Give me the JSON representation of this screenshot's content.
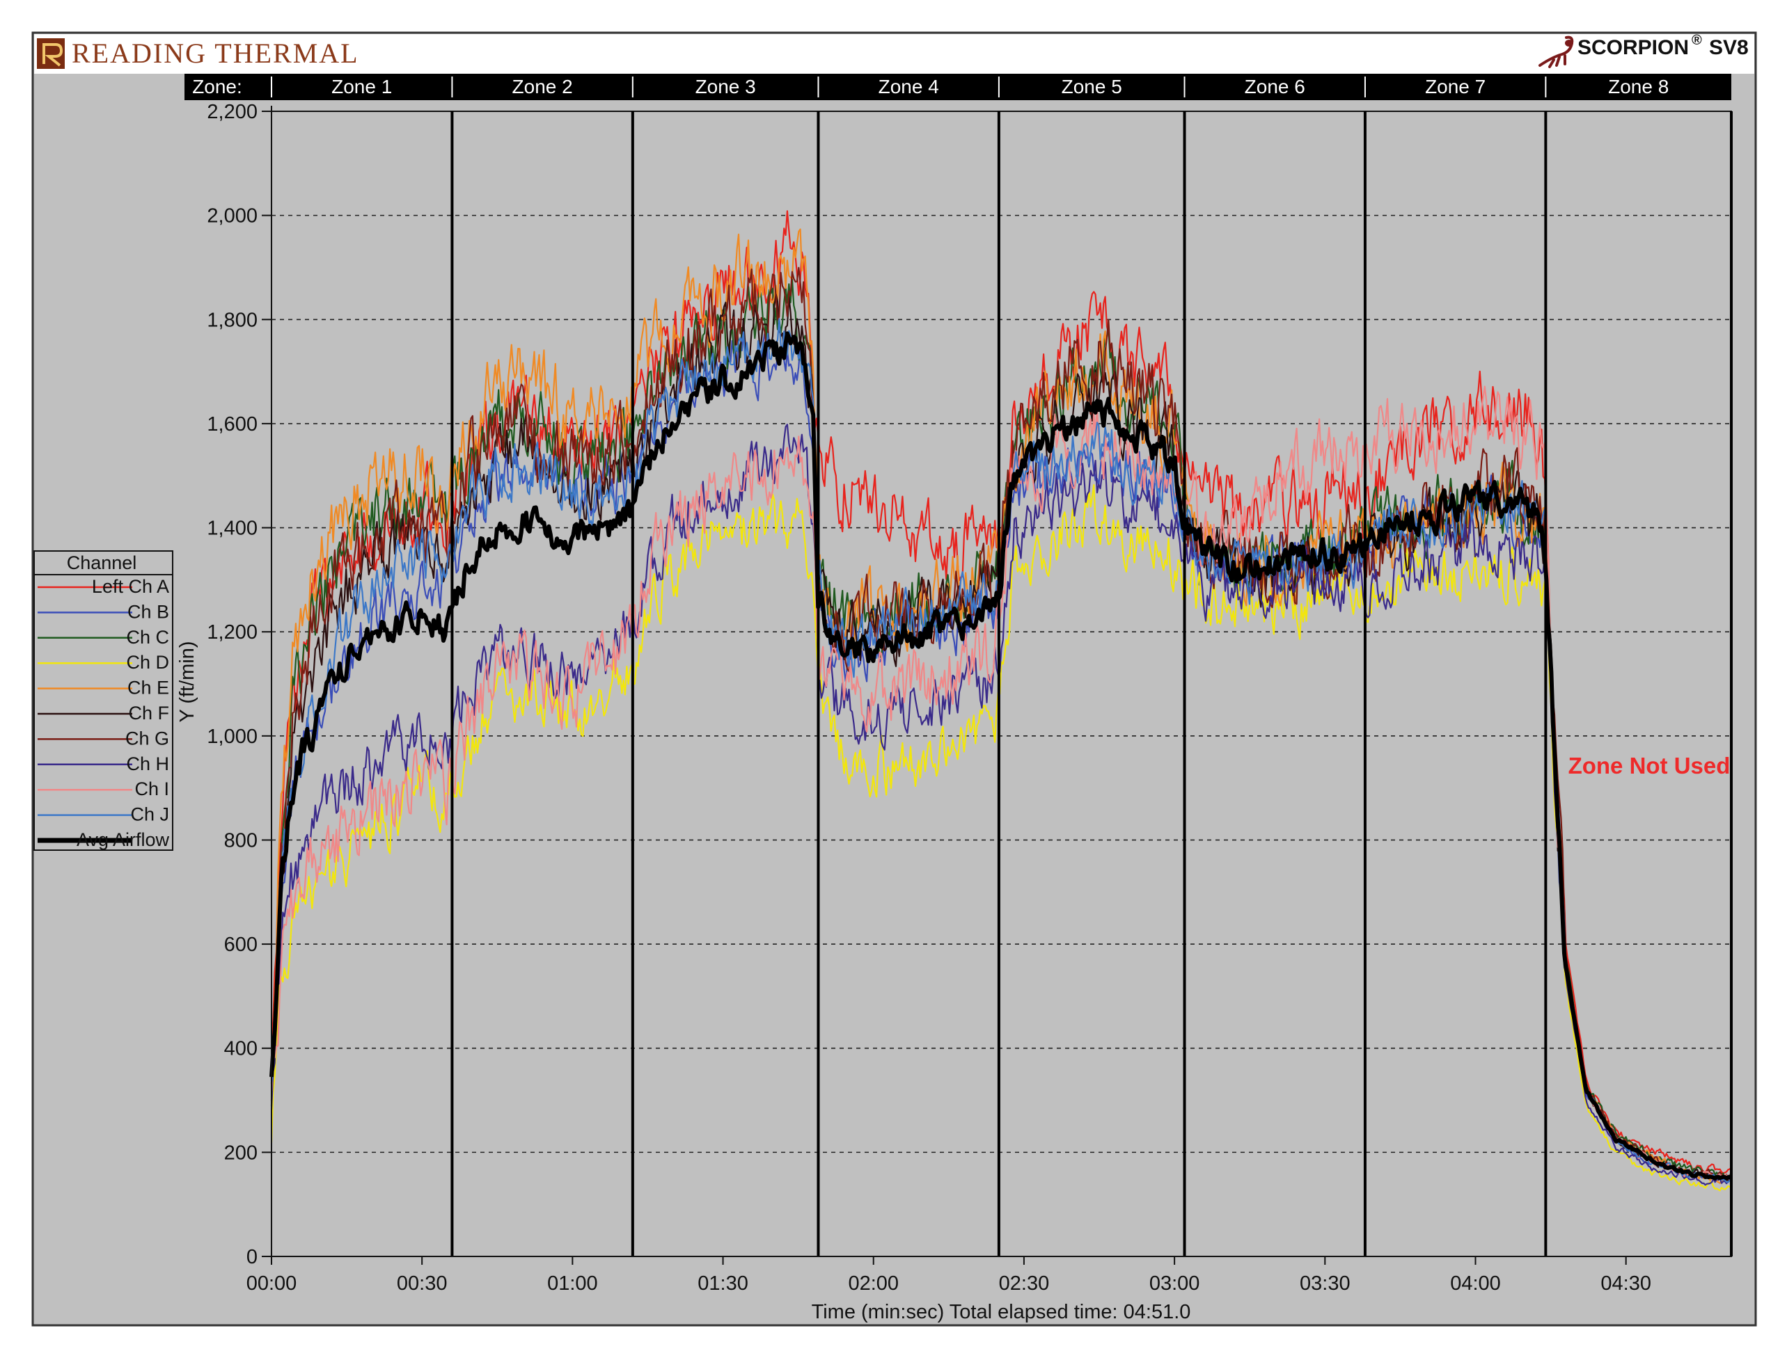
{
  "header": {
    "brand": "READING THERMAL",
    "product": "SCORPION",
    "product_mark": "®",
    "product_model": "SV8"
  },
  "zone_header": {
    "row_label": "Zone:",
    "zones": [
      "Zone 1",
      "Zone 2",
      "Zone 3",
      "Zone 4",
      "Zone 5",
      "Zone 6",
      "Zone 7",
      "Zone 8"
    ]
  },
  "legend": {
    "title": "Channel",
    "items": [
      "Left Ch A",
      "Ch B",
      "Ch C",
      "Ch D",
      "Ch E",
      "Ch F",
      "Ch G",
      "Ch H",
      "Ch I",
      "Ch J",
      "Avg Airflow"
    ]
  },
  "annotation": "Zone Not Used",
  "colors": {
    "plot_background": "#c0c0c0",
    "header_bar": "#000000",
    "annotation": "#ee2a2a"
  },
  "chart_data": {
    "type": "line",
    "title": "",
    "xlabel": "Time (min:sec) Total elapsed time: 04:51.0",
    "ylabel": "Y (ft/min)",
    "xlim": [
      0,
      291
    ],
    "ylim": [
      0,
      2200
    ],
    "x_ticks": [
      {
        "t": 0,
        "label": "00:00"
      },
      {
        "t": 30,
        "label": "00:30"
      },
      {
        "t": 60,
        "label": "01:00"
      },
      {
        "t": 90,
        "label": "01:30"
      },
      {
        "t": 120,
        "label": "02:00"
      },
      {
        "t": 150,
        "label": "02:30"
      },
      {
        "t": 180,
        "label": "03:00"
      },
      {
        "t": 210,
        "label": "03:30"
      },
      {
        "t": 240,
        "label": "04:00"
      },
      {
        "t": 270,
        "label": "04:30"
      }
    ],
    "y_ticks": [
      {
        "v": 0,
        "label": "0"
      },
      {
        "v": 200,
        "label": "200"
      },
      {
        "v": 400,
        "label": "400"
      },
      {
        "v": 600,
        "label": "600"
      },
      {
        "v": 800,
        "label": "800"
      },
      {
        "v": 1000,
        "label": "1,000"
      },
      {
        "v": 1200,
        "label": "1,200"
      },
      {
        "v": 1400,
        "label": "1,400"
      },
      {
        "v": 1600,
        "label": "1,600"
      },
      {
        "v": 1800,
        "label": "1,800"
      },
      {
        "v": 2000,
        "label": "2,000"
      },
      {
        "v": 2200,
        "label": "2,200"
      }
    ],
    "grid": "horizontal dashed",
    "legend_position": "left",
    "zone_boundaries": [
      0,
      36,
      72,
      109,
      145,
      182,
      218,
      254,
      291
    ],
    "zones": [
      {
        "name": "Zone 1",
        "start": 0,
        "end": 36
      },
      {
        "name": "Zone 2",
        "start": 36,
        "end": 72
      },
      {
        "name": "Zone 3",
        "start": 72,
        "end": 109
      },
      {
        "name": "Zone 4",
        "start": 109,
        "end": 145
      },
      {
        "name": "Zone 5",
        "start": 145,
        "end": 182
      },
      {
        "name": "Zone 6",
        "start": 182,
        "end": 218
      },
      {
        "name": "Zone 7",
        "start": 218,
        "end": 254
      },
      {
        "name": "Zone 8",
        "start": 254,
        "end": 291
      }
    ],
    "x": [
      0,
      2,
      4,
      6,
      8,
      10,
      13,
      16,
      20,
      25,
      30,
      33,
      35,
      36,
      40,
      45,
      50,
      55,
      60,
      65,
      70,
      72,
      75,
      80,
      85,
      90,
      95,
      100,
      103,
      106,
      108,
      109,
      112,
      115,
      120,
      125,
      130,
      135,
      140,
      144,
      145,
      148,
      152,
      155,
      160,
      165,
      170,
      175,
      180,
      182,
      185,
      190,
      195,
      200,
      205,
      210,
      215,
      218,
      220,
      225,
      230,
      235,
      240,
      245,
      250,
      253,
      254,
      256,
      258,
      262,
      268,
      275,
      283,
      291
    ],
    "series": [
      {
        "name": "Left Ch A",
        "color": "#e8231d",
        "width": 2.2,
        "noise": 55,
        "values": [
          380,
          850,
          1050,
          1150,
          1230,
          1260,
          1300,
          1330,
          1380,
          1420,
          1450,
          1430,
          1410,
          1440,
          1550,
          1600,
          1620,
          1580,
          1550,
          1560,
          1580,
          1560,
          1680,
          1760,
          1820,
          1850,
          1880,
          1920,
          1960,
          1880,
          1700,
          1550,
          1500,
          1470,
          1450,
          1420,
          1380,
          1360,
          1380,
          1390,
          1380,
          1600,
          1640,
          1680,
          1750,
          1800,
          1720,
          1700,
          1650,
          1520,
          1480,
          1450,
          1420,
          1440,
          1450,
          1460,
          1480,
          1450,
          1500,
          1560,
          1580,
          1600,
          1620,
          1640,
          1620,
          1560,
          1470,
          950,
          600,
          340,
          240,
          205,
          175,
          165
        ]
      },
      {
        "name": "Ch B",
        "color": "#3a4db8",
        "width": 2.2,
        "noise": 45,
        "values": [
          300,
          700,
          880,
          960,
          1020,
          1060,
          1120,
          1170,
          1210,
          1260,
          1290,
          1300,
          1310,
          1320,
          1440,
          1500,
          1520,
          1480,
          1460,
          1470,
          1490,
          1470,
          1560,
          1630,
          1680,
          1700,
          1720,
          1740,
          1760,
          1720,
          1600,
          1300,
          1200,
          1170,
          1180,
          1190,
          1200,
          1210,
          1240,
          1260,
          1300,
          1470,
          1500,
          1510,
          1530,
          1540,
          1520,
          1500,
          1480,
          1400,
          1350,
          1320,
          1310,
          1320,
          1330,
          1340,
          1350,
          1350,
          1370,
          1400,
          1420,
          1430,
          1440,
          1440,
          1420,
          1390,
          1360,
          900,
          560,
          320,
          220,
          180,
          160,
          150
        ]
      },
      {
        "name": "Ch C",
        "color": "#1f5a1f",
        "width": 2.2,
        "noise": 55,
        "values": [
          340,
          820,
          1040,
          1140,
          1210,
          1250,
          1320,
          1360,
          1420,
          1450,
          1470,
          1440,
          1420,
          1450,
          1550,
          1600,
          1610,
          1570,
          1540,
          1550,
          1570,
          1560,
          1640,
          1700,
          1740,
          1760,
          1780,
          1820,
          1840,
          1780,
          1640,
          1330,
          1240,
          1220,
          1230,
          1240,
          1260,
          1270,
          1290,
          1310,
          1330,
          1560,
          1600,
          1640,
          1690,
          1720,
          1660,
          1640,
          1600,
          1460,
          1400,
          1360,
          1330,
          1330,
          1340,
          1350,
          1360,
          1360,
          1380,
          1400,
          1420,
          1440,
          1450,
          1460,
          1440,
          1420,
          1380,
          920,
          580,
          330,
          235,
          195,
          165,
          155
        ]
      },
      {
        "name": "Ch D",
        "color": "#f2e60c",
        "width": 2.2,
        "noise": 45,
        "values": [
          250,
          520,
          620,
          650,
          680,
          700,
          740,
          780,
          820,
          860,
          900,
          880,
          860,
          900,
          1000,
          1050,
          1080,
          1060,
          1050,
          1080,
          1120,
          1130,
          1250,
          1320,
          1360,
          1380,
          1390,
          1400,
          1420,
          1400,
          1300,
          1100,
          1000,
          960,
          940,
          950,
          960,
          980,
          1000,
          1020,
          1080,
          1330,
          1360,
          1380,
          1400,
          1420,
          1380,
          1360,
          1340,
          1300,
          1270,
          1250,
          1240,
          1250,
          1260,
          1270,
          1280,
          1270,
          1280,
          1300,
          1310,
          1310,
          1320,
          1320,
          1310,
          1290,
          1270,
          860,
          520,
          290,
          200,
          160,
          140,
          130
        ]
      },
      {
        "name": "Ch E",
        "color": "#f08a24",
        "width": 2.2,
        "noise": 60,
        "values": [
          360,
          900,
          1120,
          1220,
          1290,
          1330,
          1400,
          1440,
          1480,
          1500,
          1510,
          1480,
          1460,
          1490,
          1620,
          1680,
          1700,
          1660,
          1620,
          1630,
          1650,
          1640,
          1720,
          1790,
          1840,
          1860,
          1880,
          1900,
          1920,
          1860,
          1700,
          1340,
          1250,
          1230,
          1240,
          1250,
          1260,
          1270,
          1290,
          1310,
          1350,
          1560,
          1600,
          1630,
          1680,
          1710,
          1650,
          1620,
          1580,
          1450,
          1390,
          1350,
          1320,
          1320,
          1330,
          1340,
          1350,
          1350,
          1370,
          1390,
          1410,
          1430,
          1440,
          1450,
          1430,
          1410,
          1370,
          910,
          570,
          325,
          230,
          190,
          160,
          150
        ]
      },
      {
        "name": "Ch F",
        "color": "#2a0f0f",
        "width": 2.2,
        "noise": 50,
        "values": [
          310,
          760,
          960,
          1060,
          1130,
          1180,
          1250,
          1290,
          1330,
          1360,
          1380,
          1360,
          1340,
          1370,
          1480,
          1530,
          1550,
          1510,
          1480,
          1490,
          1510,
          1500,
          1600,
          1670,
          1720,
          1740,
          1760,
          1790,
          1810,
          1760,
          1620,
          1310,
          1220,
          1200,
          1210,
          1220,
          1240,
          1250,
          1270,
          1290,
          1320,
          1520,
          1560,
          1590,
          1630,
          1660,
          1600,
          1580,
          1550,
          1430,
          1370,
          1340,
          1310,
          1310,
          1320,
          1330,
          1340,
          1340,
          1360,
          1390,
          1400,
          1420,
          1430,
          1440,
          1420,
          1400,
          1360,
          900,
          560,
          320,
          225,
          185,
          160,
          150
        ]
      },
      {
        "name": "Ch G",
        "color": "#7a1d14",
        "width": 2.2,
        "noise": 60,
        "values": [
          330,
          800,
          1000,
          1100,
          1170,
          1220,
          1290,
          1330,
          1370,
          1400,
          1420,
          1400,
          1380,
          1410,
          1520,
          1570,
          1590,
          1550,
          1520,
          1530,
          1550,
          1540,
          1640,
          1710,
          1760,
          1790,
          1820,
          1850,
          1870,
          1810,
          1660,
          1320,
          1230,
          1210,
          1220,
          1230,
          1250,
          1260,
          1280,
          1300,
          1340,
          1580,
          1620,
          1660,
          1710,
          1740,
          1680,
          1650,
          1610,
          1470,
          1400,
          1360,
          1330,
          1320,
          1330,
          1340,
          1350,
          1350,
          1370,
          1400,
          1420,
          1440,
          1460,
          1480,
          1460,
          1430,
          1390,
          920,
          575,
          330,
          232,
          192,
          162,
          152
        ]
      },
      {
        "name": "Ch H",
        "color": "#3a2a8a",
        "width": 2.2,
        "noise": 45,
        "values": [
          270,
          600,
          720,
          780,
          820,
          850,
          880,
          910,
          940,
          970,
          1000,
          980,
          960,
          1000,
          1100,
          1150,
          1170,
          1140,
          1120,
          1150,
          1190,
          1200,
          1320,
          1400,
          1450,
          1480,
          1500,
          1520,
          1540,
          1510,
          1420,
          1150,
          1080,
          1050,
          1040,
          1050,
          1070,
          1080,
          1100,
          1110,
          1160,
          1400,
          1430,
          1450,
          1470,
          1490,
          1450,
          1430,
          1410,
          1340,
          1300,
          1280,
          1270,
          1280,
          1290,
          1300,
          1310,
          1300,
          1310,
          1330,
          1340,
          1350,
          1360,
          1360,
          1350,
          1330,
          1310,
          880,
          540,
          300,
          210,
          170,
          150,
          140
        ]
      },
      {
        "name": "Ch I",
        "color": "#f08888",
        "width": 2.2,
        "noise": 55,
        "values": [
          290,
          560,
          680,
          720,
          740,
          760,
          790,
          820,
          860,
          900,
          930,
          910,
          900,
          940,
          1050,
          1100,
          1120,
          1100,
          1090,
          1120,
          1170,
          1190,
          1320,
          1400,
          1450,
          1480,
          1510,
          1540,
          1560,
          1530,
          1440,
          1180,
          1100,
          1080,
          1080,
          1090,
          1100,
          1110,
          1130,
          1150,
          1220,
          1480,
          1520,
          1540,
          1560,
          1580,
          1540,
          1520,
          1500,
          1430,
          1400,
          1410,
          1430,
          1480,
          1520,
          1540,
          1550,
          1550,
          1570,
          1580,
          1590,
          1600,
          1600,
          1600,
          1580,
          1540,
          1480,
          920,
          570,
          320,
          225,
          185,
          160,
          150
        ]
      },
      {
        "name": "Ch J",
        "color": "#3c78c8",
        "width": 2.2,
        "noise": 45,
        "values": [
          300,
          720,
          900,
          990,
          1060,
          1110,
          1180,
          1230,
          1280,
          1320,
          1350,
          1330,
          1320,
          1340,
          1460,
          1510,
          1530,
          1490,
          1460,
          1470,
          1490,
          1480,
          1570,
          1640,
          1690,
          1710,
          1730,
          1750,
          1770,
          1730,
          1610,
          1290,
          1200,
          1180,
          1190,
          1200,
          1220,
          1230,
          1250,
          1270,
          1300,
          1480,
          1510,
          1520,
          1540,
          1550,
          1530,
          1510,
          1490,
          1410,
          1360,
          1330,
          1310,
          1320,
          1330,
          1340,
          1350,
          1350,
          1370,
          1400,
          1410,
          1430,
          1440,
          1440,
          1420,
          1400,
          1360,
          900,
          560,
          320,
          222,
          182,
          158,
          148
        ]
      },
      {
        "name": "Avg Airflow",
        "color": "#000000",
        "width": 6,
        "noise": 25,
        "values": [
          320,
          720,
          890,
          960,
          1010,
          1050,
          1110,
          1150,
          1190,
          1220,
          1240,
          1220,
          1200,
          1240,
          1350,
          1400,
          1420,
          1390,
          1370,
          1390,
          1420,
          1420,
          1530,
          1600,
          1650,
          1680,
          1700,
          1730,
          1750,
          1720,
          1600,
          1270,
          1190,
          1170,
          1170,
          1180,
          1200,
          1210,
          1230,
          1250,
          1290,
          1500,
          1540,
          1570,
          1600,
          1630,
          1580,
          1560,
          1530,
          1420,
          1370,
          1340,
          1320,
          1330,
          1340,
          1350,
          1360,
          1360,
          1380,
          1410,
          1420,
          1440,
          1450,
          1460,
          1440,
          1410,
          1370,
          900,
          560,
          320,
          225,
          185,
          158,
          148
        ]
      }
    ]
  }
}
